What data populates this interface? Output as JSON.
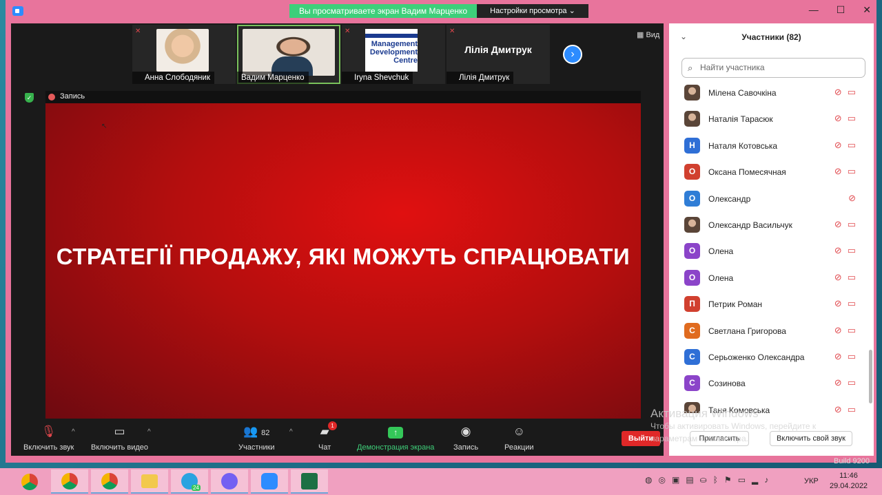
{
  "window": {
    "viewing_banner": "Вы просматриваете экран Вадим Марценко",
    "view_settings": "Настройки просмотра ⌄",
    "controls": [
      "—",
      "☐",
      "✕"
    ]
  },
  "thumbnails": [
    {
      "name": "Анна Слободяник",
      "muted": true,
      "kind": "video"
    },
    {
      "name": "Вадим Марценко",
      "muted": false,
      "kind": "video"
    },
    {
      "name": "Iryna Shevchuk",
      "muted": true,
      "kind": "logo",
      "logo_text": "Management Development Centre"
    },
    {
      "name": "Лілія Дмитрук",
      "muted": true,
      "kind": "text",
      "tile_text": "Лілія Дмитрук"
    }
  ],
  "view_label": "Вид",
  "recording_label": "Запись",
  "slide_title": "СТРАТЕГІЇ ПРОДАЖУ, ЯКІ МОЖУТЬ СПРАЦЮВАТИ",
  "toolbar": {
    "unmute": "Включить звук",
    "start_video": "Включить видео",
    "participants": "Участники",
    "participants_count": "82",
    "chat": "Чат",
    "chat_badge": "1",
    "share": "Демонстрация экрана",
    "record": "Запись",
    "reactions": "Реакции",
    "leave": "Выйти"
  },
  "panel": {
    "title": "Участники (82)",
    "search_placeholder": "Найти участника",
    "participants": [
      {
        "name": "Мілена Савочкіна",
        "initial": "",
        "color": "photo",
        "video_off": true
      },
      {
        "name": "Наталія Тарасюк",
        "initial": "",
        "color": "photo",
        "video_off": true
      },
      {
        "name": "Наталя Котовська",
        "initial": "Н",
        "color": "#2f6fd6",
        "video_off": true
      },
      {
        "name": "Оксана Помесячная",
        "initial": "О",
        "color": "#d1402f",
        "video_off": true
      },
      {
        "name": "Олександр",
        "initial": "О",
        "color": "#2f7dd6",
        "video_off": false
      },
      {
        "name": "Олександр Васильчук",
        "initial": "",
        "color": "photo",
        "video_off": true
      },
      {
        "name": "Олена",
        "initial": "О",
        "color": "#8b44c9",
        "video_off": true
      },
      {
        "name": "Олена",
        "initial": "О",
        "color": "#8b44c9",
        "video_off": true
      },
      {
        "name": "Петрик Роман",
        "initial": "П",
        "color": "#d1402f",
        "video_off": true
      },
      {
        "name": "Светлана Григорова",
        "initial": "С",
        "color": "#e06b1f",
        "video_off": true
      },
      {
        "name": "Серьоженко Олександра",
        "initial": "С",
        "color": "#2f6fd6",
        "video_off": true
      },
      {
        "name": "Созинова",
        "initial": "С",
        "color": "#8b44c9",
        "video_off": true
      },
      {
        "name": "Таня Комовська",
        "initial": "",
        "color": "photo",
        "video_off": true
      }
    ],
    "invite": "Пригласить",
    "unmute_me": "Включить свой звук"
  },
  "watermark": {
    "line1": "Активация Windows",
    "line2": "Чтобы активировать Windows, перейдите к",
    "line3": "параметрам компьютера."
  },
  "build_text": "Build 9200",
  "taskbar": {
    "lang": "УКР",
    "time": "11:46",
    "date": "29.04.2022",
    "telegram_badge": "24"
  }
}
